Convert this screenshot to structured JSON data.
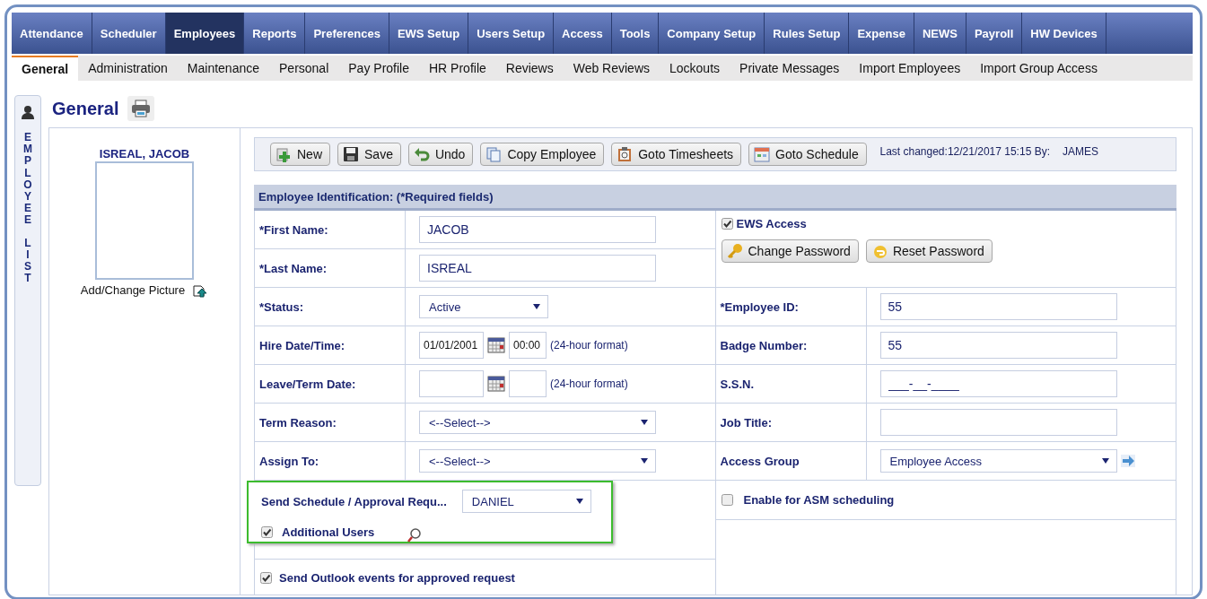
{
  "nav_tabs": [
    {
      "label": "Attendance",
      "selected": false
    },
    {
      "label": "Scheduler",
      "selected": false
    },
    {
      "label": "Employees",
      "selected": true
    },
    {
      "label": "Reports",
      "selected": false
    },
    {
      "label": "Preferences",
      "selected": false
    },
    {
      "label": "EWS Setup",
      "selected": false
    },
    {
      "label": "Users Setup",
      "selected": false
    },
    {
      "label": "Access",
      "selected": false
    },
    {
      "label": "Tools",
      "selected": false
    },
    {
      "label": "Company Setup",
      "selected": false
    },
    {
      "label": "Rules Setup",
      "selected": false
    },
    {
      "label": "Expense",
      "selected": false
    },
    {
      "label": "NEWS",
      "selected": false
    },
    {
      "label": "Payroll",
      "selected": false
    },
    {
      "label": "HW Devices",
      "selected": false
    }
  ],
  "sub_tabs": [
    {
      "label": "General",
      "selected": true
    },
    {
      "label": "Administration",
      "selected": false
    },
    {
      "label": "Maintenance",
      "selected": false
    },
    {
      "label": "Personal",
      "selected": false
    },
    {
      "label": "Pay Profile",
      "selected": false
    },
    {
      "label": "HR Profile",
      "selected": false
    },
    {
      "label": "Reviews",
      "selected": false
    },
    {
      "label": "Web Reviews",
      "selected": false
    },
    {
      "label": "Lockouts",
      "selected": false
    },
    {
      "label": "Private Messages",
      "selected": false
    },
    {
      "label": "Import Employees",
      "selected": false
    },
    {
      "label": "Import Group Access",
      "selected": false
    }
  ],
  "sidebar_tab": {
    "words": [
      "EMPLOYEE",
      "LIST"
    ]
  },
  "page_title": "General",
  "employee_name": "ISREAL, JACOB",
  "picture_link": "Add/Change Picture",
  "toolbar": {
    "buttons": [
      {
        "label": "New"
      },
      {
        "label": "Save"
      },
      {
        "label": "Undo"
      },
      {
        "label": "Copy Employee"
      },
      {
        "label": "Goto Timesheets"
      },
      {
        "label": "Goto Schedule"
      }
    ],
    "last_changed": "Last changed:12/21/2017 15:15 By:",
    "changed_by": "JAMES"
  },
  "section_title": "Employee Identification: (*Required fields)",
  "left_fields": [
    {
      "kind": "text",
      "label": "*First Name:",
      "value": "JACOB"
    },
    {
      "kind": "text",
      "label": "*Last Name:",
      "value": "ISREAL"
    },
    {
      "kind": "select",
      "label": "*Status:",
      "value": "Active"
    },
    {
      "kind": "datetime",
      "label": "Hire Date/Time:",
      "date": "01/01/2001",
      "time": "00:00",
      "hint": "(24-hour format)"
    },
    {
      "kind": "datetime",
      "label": "Leave/Term Date:",
      "hint": "(24-hour format)"
    },
    {
      "kind": "select",
      "label": "Term Reason:",
      "value": "<--Select-->"
    },
    {
      "kind": "select",
      "label": "Assign To:",
      "value": "<--Select-->"
    }
  ],
  "ews_access": {
    "label": "EWS Access",
    "checked": true
  },
  "password_buttons": [
    {
      "label": "Change Password"
    },
    {
      "label": "Reset Password"
    }
  ],
  "right_fields": [
    {
      "kind": "text",
      "label": "*Employee ID:",
      "value": "55"
    },
    {
      "kind": "text",
      "label": "Badge Number:",
      "value": "55"
    },
    {
      "kind": "text",
      "label": "S.S.N.",
      "value": "___-__-____"
    },
    {
      "kind": "text",
      "label": "Job Title:"
    },
    {
      "kind": "select",
      "label": "Access Group",
      "value": "Employee Access",
      "go": true
    }
  ],
  "approval": {
    "highlighted": true,
    "label": "Send Schedule / Approval Requ...",
    "value": "DANIEL",
    "additional_users": {
      "label": "Additional Users",
      "checked": true
    }
  },
  "asm_scheduling": {
    "label": "Enable for ASM scheduling",
    "checked": false
  },
  "outlook_events": {
    "label": "Send Outlook events for approved request",
    "checked": true
  }
}
